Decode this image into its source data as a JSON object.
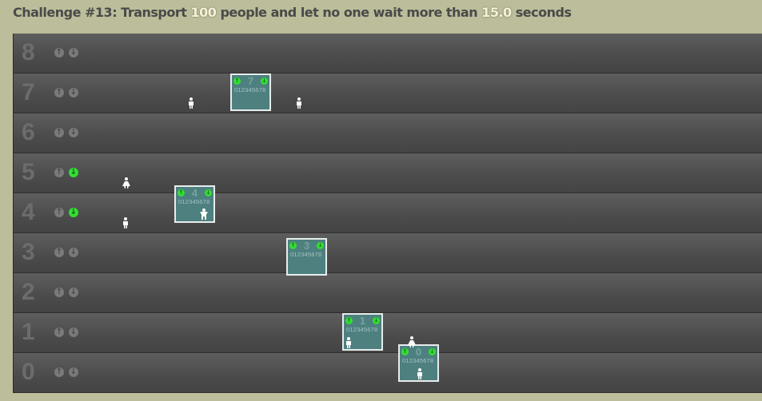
{
  "challenge": {
    "prefix": "Challenge #13: Transport ",
    "count": "100",
    "middle": " people and let no one wait more than ",
    "seconds": "15.0",
    "suffix": " seconds"
  },
  "floors": [
    {
      "label": "8",
      "up_active": false,
      "down_active": false
    },
    {
      "label": "7",
      "up_active": false,
      "down_active": false
    },
    {
      "label": "6",
      "up_active": false,
      "down_active": false
    },
    {
      "label": "5",
      "up_active": false,
      "down_active": true
    },
    {
      "label": "4",
      "up_active": false,
      "down_active": true
    },
    {
      "label": "3",
      "up_active": false,
      "down_active": false
    },
    {
      "label": "2",
      "up_active": false,
      "down_active": false
    },
    {
      "label": "1",
      "up_active": false,
      "down_active": false
    },
    {
      "label": "0",
      "up_active": false,
      "down_active": false
    }
  ],
  "icons": {
    "up": "↑",
    "down": "↓"
  },
  "elevators": [
    {
      "number": "7",
      "digits": "012345678"
    },
    {
      "number": "4",
      "digits": "012345678"
    },
    {
      "number": "3",
      "digits": "012345678"
    },
    {
      "number": "1",
      "digits": "012345678"
    },
    {
      "number": "0",
      "digits": "012345678"
    }
  ],
  "colors": {
    "elevator": "#4e8080",
    "indicator": "#33dd33",
    "background": "#bcbd9a"
  }
}
